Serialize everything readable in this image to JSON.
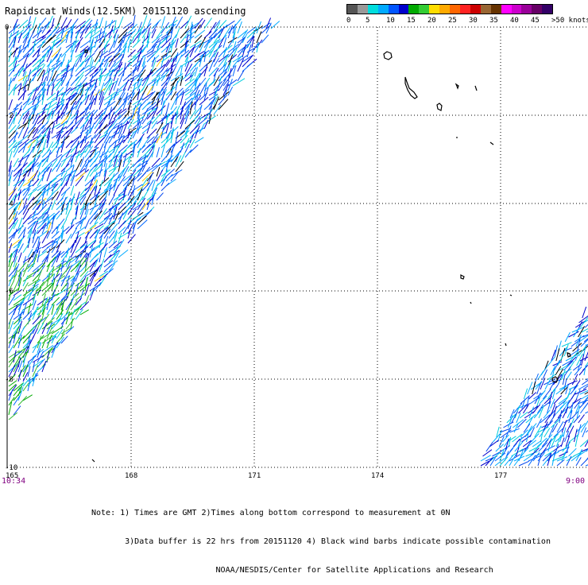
{
  "title": "Rapidscat Winds(12.5KM) 20151120 ascending",
  "legend": {
    "colors": [
      "#555555",
      "#999999",
      "#00dddd",
      "#00aaff",
      "#0055ff",
      "#0000cc",
      "#00aa00",
      "#33cc33",
      "#ffdd00",
      "#ffaa00",
      "#ff6600",
      "#ff2222",
      "#cc0000",
      "#996633",
      "#663300",
      "#ff00ff",
      "#cc00cc",
      "#990099",
      "#660066",
      "#330066"
    ],
    "labels": [
      "0",
      "5",
      "10",
      "15",
      "20",
      "25",
      "30",
      "35",
      "40",
      "45",
      ">50 knots"
    ]
  },
  "map": {
    "lon_labels": [
      "165",
      "168",
      "171",
      "174",
      "177"
    ],
    "lat_labels": [
      "0",
      "-2",
      "-4",
      "-6",
      "-8",
      "-10"
    ]
  },
  "times": {
    "left": "10:34",
    "right": "9:00"
  },
  "notes": [
    "Note: 1) Times are GMT 2)Times along bottom correspond to measurement at 0N",
    "       3)Data buffer is 22 hrs from 20151120 4) Black wind barbs indicate possible contamination",
    "                          NOAA/NESDIS/Center for Satellite Applications and Research"
  ]
}
